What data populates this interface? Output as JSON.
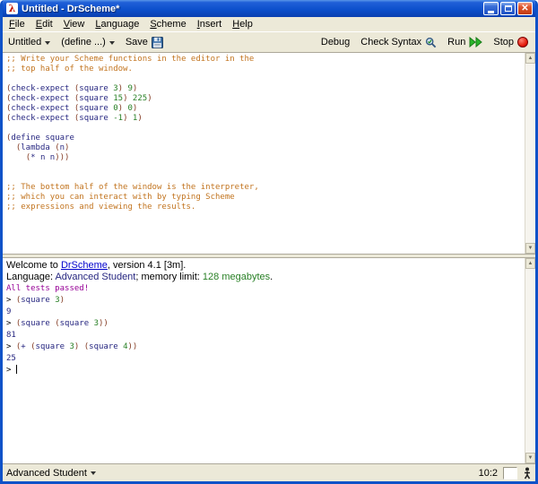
{
  "window": {
    "title": "Untitled - DrScheme*"
  },
  "menu": {
    "items": [
      "File",
      "Edit",
      "View",
      "Language",
      "Scheme",
      "Insert",
      "Help"
    ]
  },
  "toolbar": {
    "file_dropdown": "Untitled",
    "define_dropdown": "(define ...)",
    "save_label": "Save",
    "debug_label": "Debug",
    "check_syntax_label": "Check Syntax",
    "run_label": "Run",
    "stop_label": "Stop"
  },
  "statusbar": {
    "language_selector": "Advanced Student",
    "position": "10:2"
  },
  "colors": {
    "comment": "#c2741f",
    "paren": "#843c24",
    "ident": "#262680",
    "num": "#298026",
    "value": "#262680",
    "output": "#960096",
    "link": "#0000cc",
    "language": "#262680",
    "memory": "#298026",
    "titlebar_blue": "#0d50cc",
    "chrome": "#ece9d8"
  },
  "editor": {
    "lines": [
      {
        "seg": [
          {
            "t": ";; Write your Scheme functions in the editor in the",
            "c": "c"
          }
        ]
      },
      {
        "seg": [
          {
            "t": ";; top half of the window.",
            "c": "c"
          }
        ]
      },
      {
        "seg": []
      },
      {
        "seg": [
          {
            "t": "(",
            "c": "p"
          },
          {
            "t": "check-expect ",
            "c": "i"
          },
          {
            "t": "(",
            "c": "p"
          },
          {
            "t": "square ",
            "c": "i"
          },
          {
            "t": "3",
            "c": "n"
          },
          {
            "t": ")",
            "c": "p"
          },
          {
            "t": " ",
            "c": "x"
          },
          {
            "t": "9",
            "c": "n"
          },
          {
            "t": ")",
            "c": "p"
          }
        ]
      },
      {
        "seg": [
          {
            "t": "(",
            "c": "p"
          },
          {
            "t": "check-expect ",
            "c": "i"
          },
          {
            "t": "(",
            "c": "p"
          },
          {
            "t": "square ",
            "c": "i"
          },
          {
            "t": "15",
            "c": "n"
          },
          {
            "t": ")",
            "c": "p"
          },
          {
            "t": " ",
            "c": "x"
          },
          {
            "t": "225",
            "c": "n"
          },
          {
            "t": ")",
            "c": "p"
          }
        ]
      },
      {
        "seg": [
          {
            "t": "(",
            "c": "p"
          },
          {
            "t": "check-expect ",
            "c": "i"
          },
          {
            "t": "(",
            "c": "p"
          },
          {
            "t": "square ",
            "c": "i"
          },
          {
            "t": "0",
            "c": "n"
          },
          {
            "t": ")",
            "c": "p"
          },
          {
            "t": " ",
            "c": "x"
          },
          {
            "t": "0",
            "c": "n"
          },
          {
            "t": ")",
            "c": "p"
          }
        ]
      },
      {
        "seg": [
          {
            "t": "(",
            "c": "p"
          },
          {
            "t": "check-expect ",
            "c": "i"
          },
          {
            "t": "(",
            "c": "p"
          },
          {
            "t": "square ",
            "c": "i"
          },
          {
            "t": "-1",
            "c": "n"
          },
          {
            "t": ")",
            "c": "p"
          },
          {
            "t": " ",
            "c": "x"
          },
          {
            "t": "1",
            "c": "n"
          },
          {
            "t": ")",
            "c": "p"
          }
        ]
      },
      {
        "seg": []
      },
      {
        "seg": [
          {
            "t": "(",
            "c": "p"
          },
          {
            "t": "define square",
            "c": "i"
          }
        ]
      },
      {
        "seg": [
          {
            "t": "  ",
            "c": "x"
          },
          {
            "t": "(",
            "c": "p"
          },
          {
            "t": "lambda ",
            "c": "i"
          },
          {
            "t": "(",
            "c": "p"
          },
          {
            "t": "n",
            "c": "i"
          },
          {
            "t": ")",
            "c": "p"
          }
        ]
      },
      {
        "seg": [
          {
            "t": "    ",
            "c": "x"
          },
          {
            "t": "(",
            "c": "p"
          },
          {
            "t": "* n n",
            "c": "i"
          },
          {
            "t": ")))",
            "c": "p"
          }
        ]
      },
      {
        "seg": []
      },
      {
        "seg": []
      },
      {
        "seg": [
          {
            "t": ";; The bottom half of the window is the interpreter,",
            "c": "c"
          }
        ]
      },
      {
        "seg": [
          {
            "t": ";; which you can interact with by typing Scheme",
            "c": "c"
          }
        ]
      },
      {
        "seg": [
          {
            "t": ";; expressions and viewing the results.",
            "c": "c"
          }
        ]
      }
    ]
  },
  "interactions": {
    "lines": [
      {
        "sans": true,
        "seg": [
          {
            "t": "Welcome to ",
            "c": "x"
          },
          {
            "t": "DrScheme",
            "c": "link"
          },
          {
            "t": ", version 4.1 [3m].",
            "c": "x"
          }
        ]
      },
      {
        "sans": true,
        "seg": [
          {
            "t": "Language: ",
            "c": "x"
          },
          {
            "t": "Advanced Student",
            "c": "lang"
          },
          {
            "t": "; memory limit: ",
            "c": "x"
          },
          {
            "t": "128 megabytes",
            "c": "mem"
          },
          {
            "t": ".",
            "c": "x"
          }
        ]
      },
      {
        "seg": [
          {
            "t": "All tests passed!",
            "c": "out"
          }
        ]
      },
      {
        "seg": [
          {
            "t": "> ",
            "c": "x"
          },
          {
            "t": "(",
            "c": "p"
          },
          {
            "t": "square ",
            "c": "i"
          },
          {
            "t": "3",
            "c": "n"
          },
          {
            "t": ")",
            "c": "p"
          }
        ]
      },
      {
        "seg": [
          {
            "t": "9",
            "c": "val"
          }
        ]
      },
      {
        "seg": [
          {
            "t": "> ",
            "c": "x"
          },
          {
            "t": "(",
            "c": "p"
          },
          {
            "t": "square ",
            "c": "i"
          },
          {
            "t": "(",
            "c": "p"
          },
          {
            "t": "square ",
            "c": "i"
          },
          {
            "t": "3",
            "c": "n"
          },
          {
            "t": "))",
            "c": "p"
          }
        ]
      },
      {
        "seg": [
          {
            "t": "81",
            "c": "val"
          }
        ]
      },
      {
        "seg": [
          {
            "t": "> ",
            "c": "x"
          },
          {
            "t": "(",
            "c": "p"
          },
          {
            "t": "+ ",
            "c": "i"
          },
          {
            "t": "(",
            "c": "p"
          },
          {
            "t": "square ",
            "c": "i"
          },
          {
            "t": "3",
            "c": "n"
          },
          {
            "t": ")",
            "c": "p"
          },
          {
            "t": " ",
            "c": "x"
          },
          {
            "t": "(",
            "c": "p"
          },
          {
            "t": "square ",
            "c": "i"
          },
          {
            "t": "4",
            "c": "n"
          },
          {
            "t": "))",
            "c": "p"
          }
        ]
      },
      {
        "seg": [
          {
            "t": "25",
            "c": "val"
          }
        ]
      },
      {
        "caret": true,
        "seg": [
          {
            "t": "> ",
            "c": "x"
          }
        ]
      }
    ]
  }
}
